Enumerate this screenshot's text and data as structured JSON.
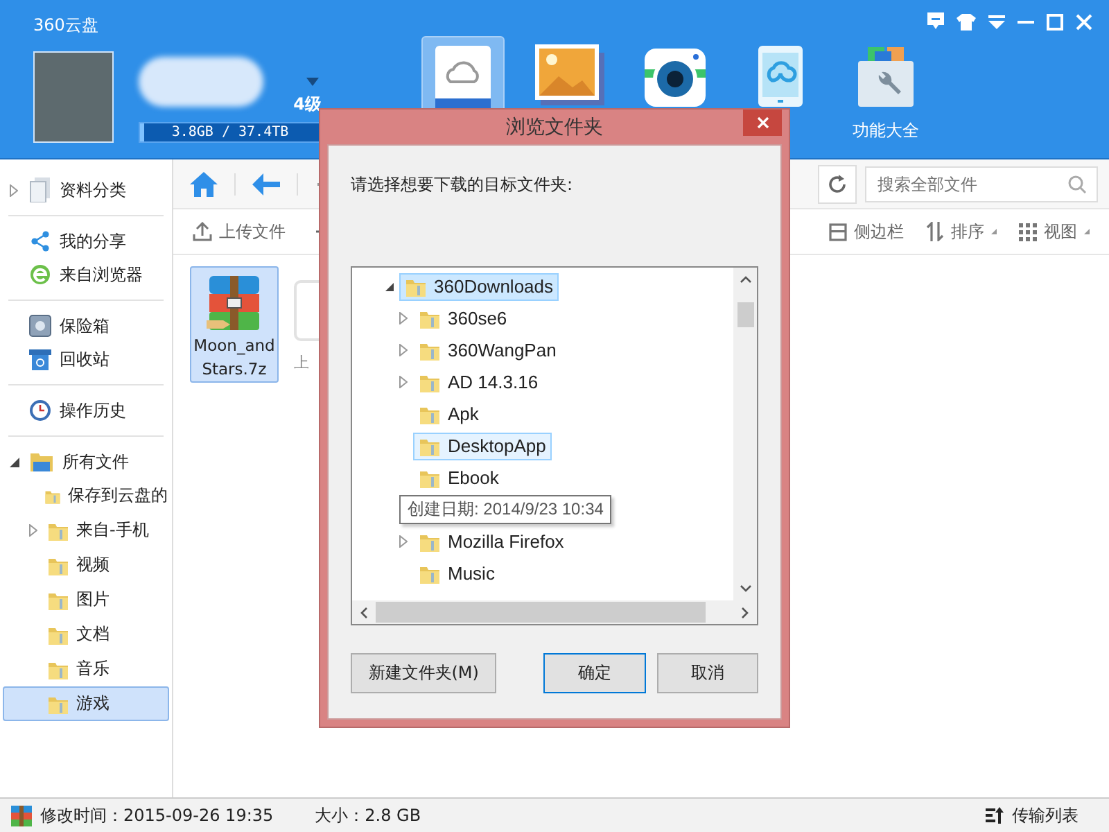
{
  "window": {
    "title": "360云盘"
  },
  "account": {
    "level": "4级",
    "quota": {
      "text": "3.8GB / 37.4TB",
      "level": 0.02
    }
  },
  "nav_tiles": [
    {
      "kind": "disk",
      "selected": true
    },
    {
      "kind": "photo",
      "selected": false
    },
    {
      "kind": "camera",
      "selected": false
    },
    {
      "kind": "phone",
      "selected": false
    },
    {
      "kind": "tools",
      "selected": false,
      "label": "功能大全"
    }
  ],
  "sidebar": {
    "items": [
      {
        "label": "资料分类",
        "kind": "category"
      },
      {
        "kind": "divider"
      },
      {
        "label": "我的分享",
        "kind": "share"
      },
      {
        "label": "来自浏览器",
        "kind": "browser"
      },
      {
        "kind": "divider"
      },
      {
        "label": "保险箱",
        "kind": "safe"
      },
      {
        "label": "回收站",
        "kind": "trash"
      },
      {
        "kind": "divider"
      },
      {
        "label": "操作历史",
        "kind": "history"
      },
      {
        "kind": "divider"
      },
      {
        "label": "所有文件",
        "kind": "files",
        "expanded": true,
        "children": [
          {
            "label": "保存到云盘的",
            "selected": false,
            "expandable": false
          },
          {
            "label": "来自-手机",
            "selected": false,
            "expandable": true
          },
          {
            "label": "视频",
            "selected": false,
            "expandable": false
          },
          {
            "label": "图片",
            "selected": false,
            "expandable": false
          },
          {
            "label": "文档",
            "selected": false,
            "expandable": false
          },
          {
            "label": "音乐",
            "selected": false,
            "expandable": false
          },
          {
            "label": "游戏",
            "selected": true,
            "expandable": false
          }
        ]
      }
    ]
  },
  "toolbar": {
    "search": {
      "placeholder": "搜索全部文件"
    },
    "upload": "上传文件",
    "right": [
      {
        "kind": "sidebar",
        "label": "侧边栏"
      },
      {
        "kind": "sort",
        "label": "排序"
      },
      {
        "kind": "view",
        "label": "视图"
      }
    ]
  },
  "files": [
    {
      "name": "Moon_and Stars.7z",
      "kind": "archive",
      "selected": true
    },
    {
      "name": "上",
      "kind": "upload"
    }
  ],
  "dialog": {
    "title": "浏览文件夹",
    "prompt": "请选择想要下载的目标文件夹:",
    "tree": {
      "label": "360Downloads",
      "expanded": true,
      "selected": true,
      "children": [
        {
          "label": "360se6",
          "expandable": true,
          "hovered": false
        },
        {
          "label": "360WangPan",
          "expandable": true,
          "hovered": false
        },
        {
          "label": "AD 14.3.16",
          "expandable": true,
          "hovered": false
        },
        {
          "label": "Apk",
          "expandable": false,
          "hovered": false
        },
        {
          "label": "DesktopApp",
          "expandable": false,
          "hovered": true
        },
        {
          "label": "Ebook",
          "expandable": false,
          "hovered": false
        },
        {
          "label": "Mozilla Firefox",
          "expandable": true,
          "hovered": false
        },
        {
          "label": "Music",
          "expandable": false,
          "hovered": false
        }
      ]
    },
    "tooltip": "创建日期: 2014/9/23 10:34",
    "buttons": [
      {
        "label": "新建文件夹(M)",
        "default": false
      },
      {
        "label": "确定",
        "default": true
      },
      {
        "label": "取消",
        "default": false
      }
    ]
  },
  "status_bar": {
    "modified": "修改时间：2015-09-26 19:35",
    "size": "大小：2.8 GB",
    "transfers": "传输列表"
  }
}
